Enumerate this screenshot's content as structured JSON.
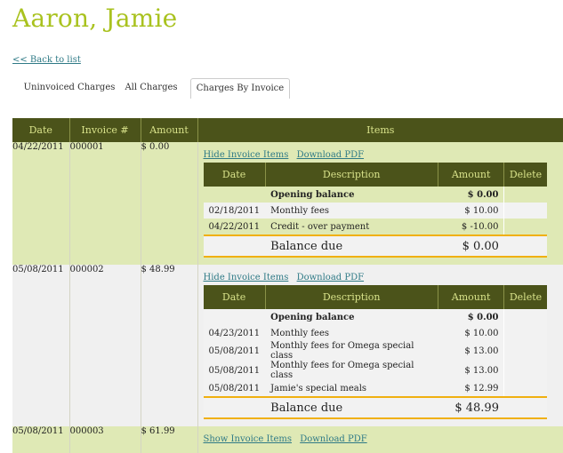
{
  "page": {
    "title": "Aaron, Jamie",
    "back_link": "<< Back to list"
  },
  "tabs": [
    {
      "label": "Uninvoiced Charges",
      "active": false
    },
    {
      "label": "All Charges",
      "active": false
    },
    {
      "label": "Charges By Invoice",
      "active": true
    }
  ],
  "table": {
    "headers": {
      "date": "Date",
      "invoice": "Invoice #",
      "amount": "Amount",
      "items": "Items"
    },
    "inner_headers": {
      "date": "Date",
      "description": "Description",
      "amount": "Amount",
      "delete": "Delete"
    },
    "balance_label": "Balance due",
    "invoices": [
      {
        "date": "04/22/2011",
        "number": "000001",
        "amount": "$ 0.00",
        "toggle_label": "Hide Invoice Items",
        "download_label": "Download PDF",
        "opening": {
          "label": "Opening balance",
          "amount": "$ 0.00"
        },
        "items": [
          {
            "date": "02/18/2011",
            "description": "Monthly fees",
            "amount": "$ 10.00"
          },
          {
            "date": "04/22/2011",
            "description": "Credit - over payment",
            "amount": "$ -10.00"
          }
        ],
        "balance": "$ 0.00"
      },
      {
        "date": "05/08/2011",
        "number": "000002",
        "amount": "$ 48.99",
        "toggle_label": "Hide Invoice Items",
        "download_label": "Download PDF",
        "opening": {
          "label": "Opening balance",
          "amount": "$ 0.00"
        },
        "items": [
          {
            "date": "04/23/2011",
            "description": "Monthly fees",
            "amount": "$ 10.00"
          },
          {
            "date": "05/08/2011",
            "description": "Monthly fees for Omega special class",
            "amount": "$ 13.00"
          },
          {
            "date": "05/08/2011",
            "description": "Monthly fees for Omega special class",
            "amount": "$ 13.00"
          },
          {
            "date": "05/08/2011",
            "description": "Jamie's special meals",
            "amount": "$ 12.99"
          }
        ],
        "balance": "$ 48.99"
      },
      {
        "date": "05/08/2011",
        "number": "000003",
        "amount": "$ 61.99",
        "toggle_label": "Show Invoice Items",
        "download_label": "Download PDF"
      }
    ]
  },
  "colors": {
    "accent": "#a9c21f",
    "header_bg": "#4b531a",
    "header_text": "#d8e28a",
    "row_green": "#dfe9b5",
    "balance_line": "#f0b010"
  }
}
